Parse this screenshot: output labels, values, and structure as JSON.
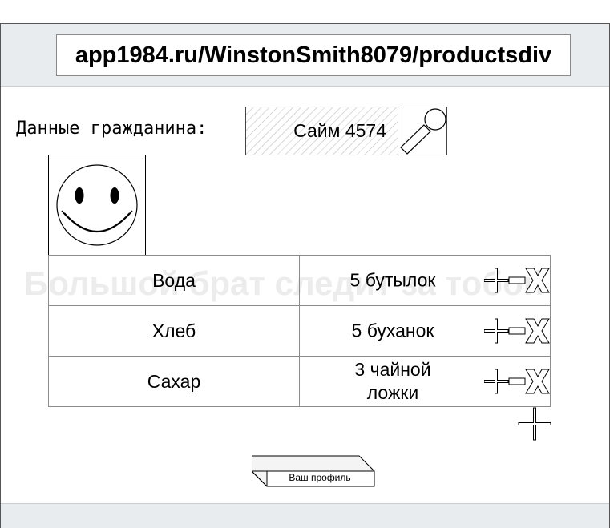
{
  "browser": {
    "url": "app1984.ru/WinstonSmith8079/productsdiv"
  },
  "citizen": {
    "label": "Данные гражданина:",
    "search_value": "Сайм 4574",
    "search_icon": "magnifier-icon"
  },
  "avatar": {
    "icon": "smiley-face-icon"
  },
  "watermark": "Большой брат следит за тобой",
  "products": [
    {
      "name": "Вода",
      "qty": "5 бутылок"
    },
    {
      "name": "Хлеб",
      "qty": "5 буханок"
    },
    {
      "name": "Сахар",
      "qty_line1": "3 чайной",
      "qty_line2": "ложки"
    }
  ],
  "row_controls": {
    "increase_icon": "plus-icon",
    "decrease_icon": "minus-icon",
    "delete_icon": "x-icon"
  },
  "add_product": {
    "icon": "plus-icon"
  },
  "profile_button": {
    "label": "Ваш профиль"
  }
}
